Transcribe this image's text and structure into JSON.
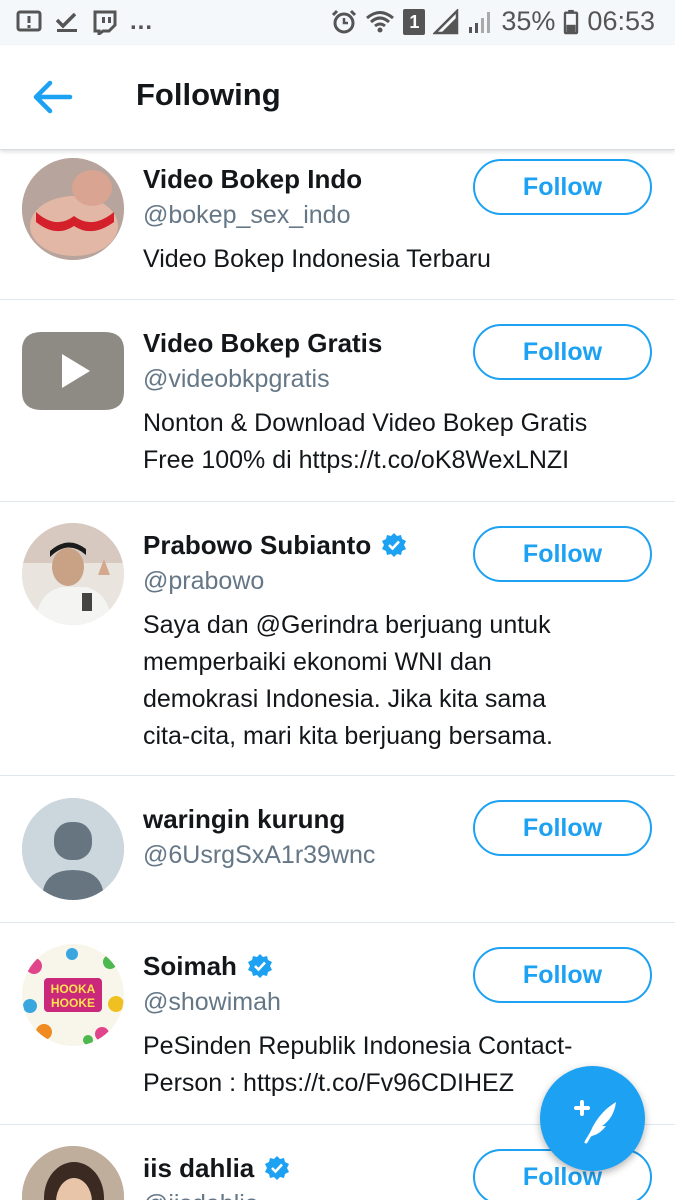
{
  "status_bar": {
    "battery_percent": "35%",
    "time": "06:53",
    "sim_badge": "1",
    "overflow": "...",
    "left_icons": [
      "alert-icon",
      "check-icon",
      "twitch-icon"
    ],
    "right_icons": [
      "alarm-icon",
      "wifi-icon",
      "signal-icon",
      "signal-icon",
      "battery-icon"
    ]
  },
  "header": {
    "title": "Following",
    "back_icon": "arrow-left-icon"
  },
  "accent_color": "#1da1f2",
  "users": [
    {
      "name": "Video Bokep Indo",
      "handle": "@bokep_sex_indo",
      "verified": false,
      "bio": "Video Bokep Indonesia Terbaru",
      "follow_label": "Follow"
    },
    {
      "name": "Video Bokep Gratis",
      "handle": "@videobkpgratis",
      "verified": false,
      "bio_lines": [
        "Nonton & Download Video Bokep Gratis",
        "Free 100% di https://t.co/oK8WexLNZI"
      ],
      "follow_label": "Follow"
    },
    {
      "name": "Prabowo Subianto",
      "handle": "@prabowo",
      "verified": true,
      "bio_lines": [
        "Saya dan @Gerindra berjuang untuk",
        "memperbaiki ekonomi WNI dan",
        "demokrasi Indonesia. Jika kita sama",
        "cita-cita, mari kita berjuang bersama."
      ],
      "follow_label": "Follow"
    },
    {
      "name": "waringin kurung",
      "handle": "@6UsrgSxA1r39wnc",
      "verified": false,
      "follow_label": "Follow"
    },
    {
      "name": "Soimah",
      "handle": "@showimah",
      "verified": true,
      "bio_lines": [
        "PeSinden Republik Indonesia Contact-",
        "Person : https://t.co/Fv96CDIHEZ"
      ],
      "follow_label": "Follow",
      "avatar_text": [
        "HOOKA",
        "HOOKE"
      ]
    },
    {
      "name": "iis dahlia",
      "handle": "@iisdahlia",
      "verified": true,
      "follow_label": "Follow"
    }
  ],
  "fab": {
    "icon": "compose-tweet-icon"
  }
}
